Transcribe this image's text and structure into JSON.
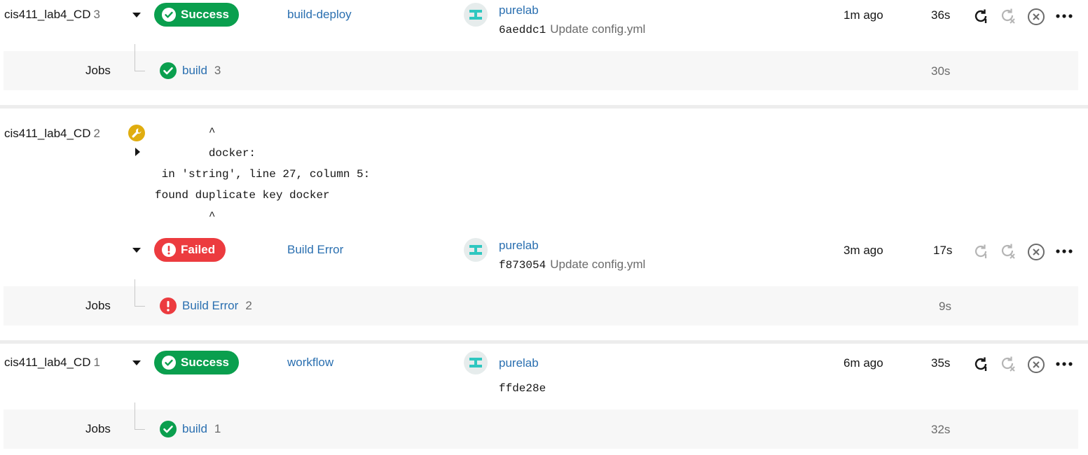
{
  "pipelines": [
    {
      "project": "cis411_lab4_CD",
      "number": "3",
      "status": "Success",
      "workflow": "build-deploy",
      "user": "purelab",
      "commit_hash": "6aeddc1",
      "commit_msg": "Update config.yml",
      "time_ago": "1m ago",
      "duration": "36s",
      "jobs_label": "Jobs",
      "job": {
        "name": "build",
        "number": "3",
        "duration": "30s"
      }
    },
    {
      "project": "cis411_lab4_CD",
      "number": "2",
      "error_lines": [
        "        ^",
        "        docker:",
        " in 'string', line 27, column 5:",
        "found duplicate key docker",
        "        ^"
      ],
      "status": "Failed",
      "workflow": "Build Error",
      "user": "purelab",
      "commit_hash": "f873054",
      "commit_msg": "Update config.yml",
      "time_ago": "3m ago",
      "duration": "17s",
      "jobs_label": "Jobs",
      "job": {
        "name": "Build Error",
        "number": "2",
        "duration": "9s"
      }
    },
    {
      "project": "cis411_lab4_CD",
      "number": "1",
      "status": "Success",
      "workflow": "workflow",
      "user": "purelab",
      "commit_hash": "ffde28e",
      "commit_msg": "",
      "time_ago": "6m ago",
      "duration": "35s",
      "jobs_label": "Jobs",
      "job": {
        "name": "build",
        "number": "1",
        "duration": "32s"
      }
    }
  ],
  "icons": {
    "rerun": "rerun-icon",
    "rerun_failed": "rerun-from-failed-icon",
    "cancel": "cancel-icon",
    "more": "more-options-icon",
    "success": "check-circle-icon",
    "failed": "exclamation-circle-icon",
    "wrench": "wrench-icon"
  },
  "colors": {
    "success": "#0a9f4e",
    "failed": "#ec3b3f",
    "link": "#2a6fb0",
    "setup_warning": "#e0ad0f"
  }
}
